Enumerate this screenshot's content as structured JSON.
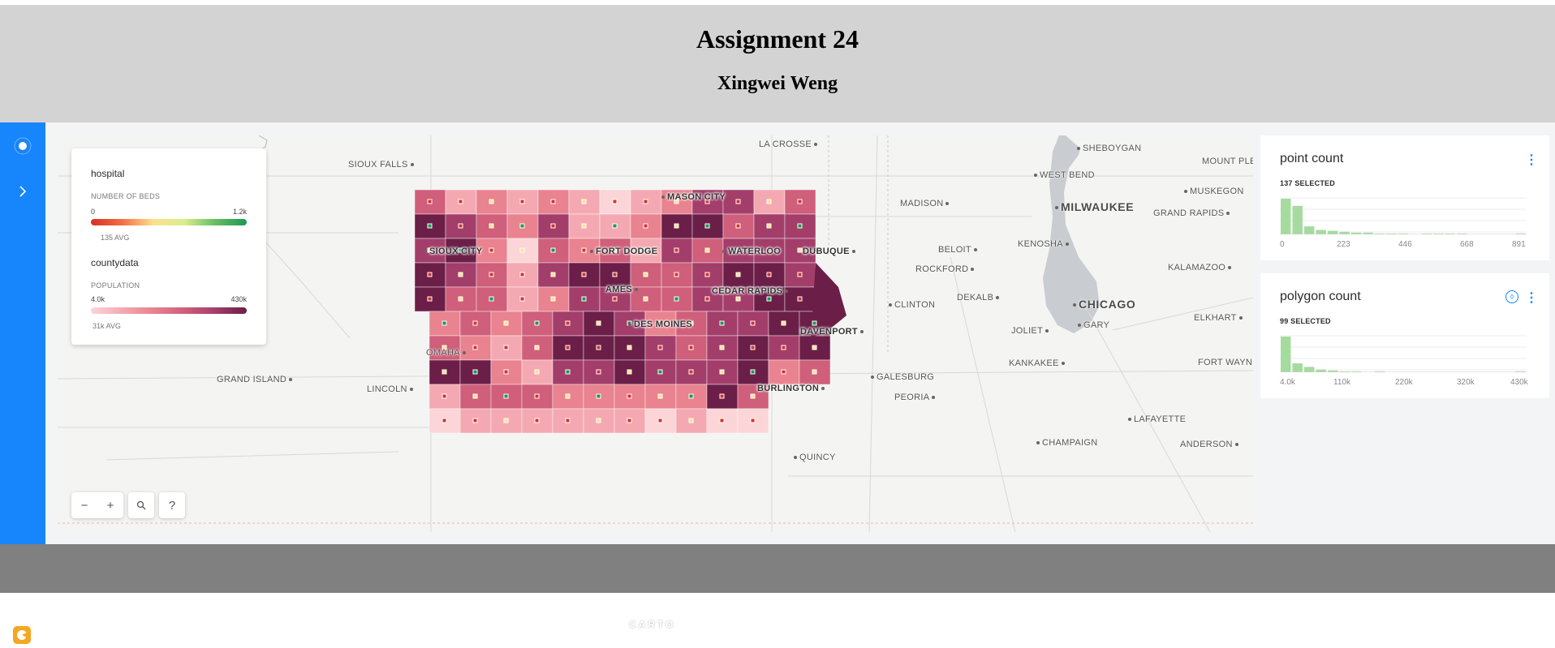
{
  "header": {
    "title": "Assignment 24",
    "subtitle": "Xingwei Weng"
  },
  "colors": {
    "header_bg": "#d3d3d3",
    "footer_bg": "#808080",
    "sidebar_bg": "#1785fb",
    "county_ramp": [
      "#fcd5d8",
      "#f4a9b2",
      "#e9838f",
      "#cf5f7a",
      "#a33e6b",
      "#6b1f48"
    ],
    "hospital_ramp": [
      "#d73027",
      "#fee08b",
      "#1a9850"
    ],
    "histogram": "#a6dba0"
  },
  "sidebar": {
    "top_icon": "layers-icon",
    "expand_icon": "chevron-right-icon",
    "logo_icon": "carto-logo-icon"
  },
  "legend": {
    "hospital": {
      "title": "hospital",
      "variable": "NUMBER OF BEDS",
      "min": "0",
      "max": "1.2k",
      "avg": "135 AVG"
    },
    "countydata": {
      "title": "countydata",
      "variable": "POPULATION",
      "min": "4.0k",
      "max": "430k",
      "avg": "31k AVG"
    }
  },
  "controls": {
    "zoom_out": "−",
    "zoom_in": "+",
    "search": "⚲",
    "help": "?"
  },
  "map": {
    "attribution": "CARTO",
    "cities": [
      {
        "id": "la-crosse",
        "label": "LA CROSSE"
      },
      {
        "id": "sheboygan",
        "label": "SHEBOYGAN"
      },
      {
        "id": "mount-pleasant",
        "label": "MOUNT PLE"
      },
      {
        "id": "sioux-falls",
        "label": "SIOUX FALLS"
      },
      {
        "id": "west-bend",
        "label": "WEST BEND"
      },
      {
        "id": "muskegon",
        "label": "MUSKEGON"
      },
      {
        "id": "madison",
        "label": "MADISON"
      },
      {
        "id": "milwaukee",
        "label": "MILWAUKEE"
      },
      {
        "id": "grand-rapids",
        "label": "GRAND RAPIDS"
      },
      {
        "id": "mason-city",
        "label": "MASON CITY"
      },
      {
        "id": "sioux-city",
        "label": "SIOUX CITY"
      },
      {
        "id": "fort-dodge",
        "label": "FORT DODGE"
      },
      {
        "id": "waterloo",
        "label": "WATERLOO"
      },
      {
        "id": "dubuque",
        "label": "DUBUQUE"
      },
      {
        "id": "beloit",
        "label": "BELOIT"
      },
      {
        "id": "kenosha",
        "label": "KENOSHA"
      },
      {
        "id": "rockford",
        "label": "ROCKFORD"
      },
      {
        "id": "kalamazoo",
        "label": "KALAMAZOO"
      },
      {
        "id": "ames",
        "label": "AMES"
      },
      {
        "id": "cedar-rapids",
        "label": "CEDAR RAPIDS"
      },
      {
        "id": "dekalb",
        "label": "DEKALB"
      },
      {
        "id": "clinton",
        "label": "CLINTON"
      },
      {
        "id": "chicago",
        "label": "CHICAGO"
      },
      {
        "id": "elkhart",
        "label": "ELKHART"
      },
      {
        "id": "des-moines",
        "label": "DES MOINES"
      },
      {
        "id": "davenport",
        "label": "DAVENPORT"
      },
      {
        "id": "gary",
        "label": "GARY"
      },
      {
        "id": "joliet",
        "label": "JOLIET"
      },
      {
        "id": "omaha",
        "label": "OMAHA"
      },
      {
        "id": "kankakee",
        "label": "KANKAKEE"
      },
      {
        "id": "fort-wayne",
        "label": "FORT WAYN"
      },
      {
        "id": "grand-island",
        "label": "GRAND ISLAND"
      },
      {
        "id": "lincoln",
        "label": "LINCOLN"
      },
      {
        "id": "galesburg",
        "label": "GALESBURG"
      },
      {
        "id": "burlington",
        "label": "BURLINGTON"
      },
      {
        "id": "peoria",
        "label": "PEORIA"
      },
      {
        "id": "lafayette",
        "label": "LAFAYETTE"
      },
      {
        "id": "champaign",
        "label": "CHAMPAIGN"
      },
      {
        "id": "anderson",
        "label": "ANDERSON"
      },
      {
        "id": "quincy",
        "label": "QUINCY"
      }
    ]
  },
  "widgets": [
    {
      "title": "point count",
      "selected": "137 SELECTED",
      "menu_icon": "more-vertical-icon",
      "ticks": [
        "0",
        "223",
        "446",
        "668",
        "891"
      ],
      "bins": [
        40,
        32,
        9,
        5,
        4,
        3,
        2,
        2,
        1,
        1,
        1,
        0,
        1,
        1,
        1,
        1,
        0,
        0,
        0,
        0,
        1
      ]
    },
    {
      "title": "polygon count",
      "selected": "99 SELECTED",
      "menu_icon": "more-vertical-icon",
      "filter_icon": "drop-icon",
      "ticks": [
        "4.0k",
        "110k",
        "220k",
        "320k",
        "430k"
      ],
      "bins": [
        40,
        10,
        6,
        3,
        2,
        1,
        1,
        0,
        1,
        0,
        0,
        0,
        0,
        0,
        0,
        0,
        0,
        0,
        0,
        0,
        1
      ]
    }
  ]
}
